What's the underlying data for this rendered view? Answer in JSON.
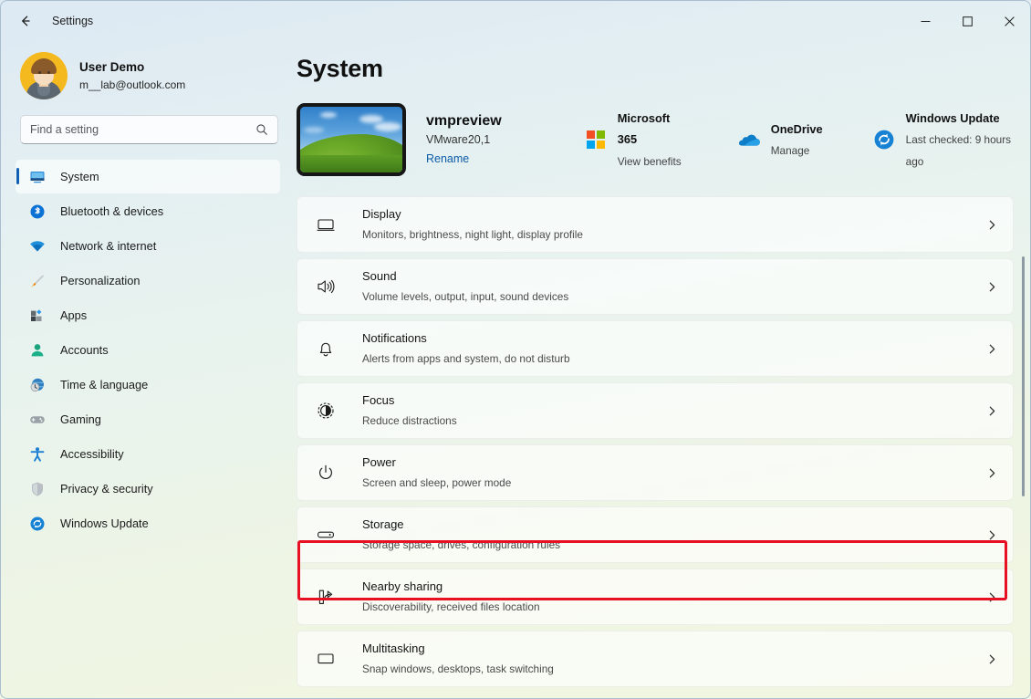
{
  "window": {
    "app_title": "Settings",
    "back_icon": "arrow-left-icon",
    "controls": {
      "minimize": "–",
      "maximize": "□",
      "close": "✕"
    }
  },
  "account": {
    "name": "User Demo",
    "email": "m__lab@outlook.com",
    "avatar_color": "#f5b920"
  },
  "search": {
    "placeholder": "Find a setting",
    "value": "",
    "icon": "search-icon"
  },
  "sidebar": {
    "items": [
      {
        "label": "System",
        "icon": "monitor-icon",
        "selected": true
      },
      {
        "label": "Bluetooth & devices",
        "icon": "bluetooth-icon",
        "selected": false
      },
      {
        "label": "Network & internet",
        "icon": "wifi-icon",
        "selected": false
      },
      {
        "label": "Personalization",
        "icon": "paintbrush-icon",
        "selected": false
      },
      {
        "label": "Apps",
        "icon": "apps-grid-icon",
        "selected": false
      },
      {
        "label": "Accounts",
        "icon": "person-icon",
        "selected": false
      },
      {
        "label": "Time & language",
        "icon": "clock-globe-icon",
        "selected": false
      },
      {
        "label": "Gaming",
        "icon": "gamepad-icon",
        "selected": false
      },
      {
        "label": "Accessibility",
        "icon": "accessibility-person-icon",
        "selected": false
      },
      {
        "label": "Privacy & security",
        "icon": "shield-icon",
        "selected": false
      },
      {
        "label": "Windows Update",
        "icon": "update-sync-icon",
        "selected": false
      }
    ]
  },
  "main": {
    "page_title": "System",
    "device": {
      "name": "vmpreview",
      "model": "VMware20,1",
      "rename_label": "Rename",
      "thumbnail": "bliss-wallpaper-thumbnail"
    },
    "quick_links": [
      {
        "title": "Microsoft 365",
        "subtitle": "View benefits",
        "icon": "microsoft-logo-icon"
      },
      {
        "title": "OneDrive",
        "subtitle": "Manage",
        "icon": "onedrive-cloud-icon"
      },
      {
        "title": "Windows Update",
        "subtitle": "Last checked: 9 hours ago",
        "icon": "update-sync-icon"
      }
    ],
    "settings_rows": [
      {
        "title": "Display",
        "subtitle": "Monitors, brightness, night light, display profile",
        "icon": "monitor-icon",
        "chevron": "chevron-right-icon",
        "highlighted": false
      },
      {
        "title": "Sound",
        "subtitle": "Volume levels, output, input, sound devices",
        "icon": "speaker-icon",
        "chevron": "chevron-right-icon",
        "highlighted": false
      },
      {
        "title": "Notifications",
        "subtitle": "Alerts from apps and system, do not disturb",
        "icon": "bell-icon",
        "chevron": "chevron-right-icon",
        "highlighted": false
      },
      {
        "title": "Focus",
        "subtitle": "Reduce distractions",
        "icon": "focus-moon-icon",
        "chevron": "chevron-right-icon",
        "highlighted": false
      },
      {
        "title": "Power",
        "subtitle": "Screen and sleep, power mode",
        "icon": "power-icon",
        "chevron": "chevron-right-icon",
        "highlighted": false
      },
      {
        "title": "Storage",
        "subtitle": "Storage space, drives, configuration rules",
        "icon": "drive-icon",
        "chevron": "chevron-right-icon",
        "highlighted": true
      },
      {
        "title": "Nearby sharing",
        "subtitle": "Discoverability, received files location",
        "icon": "share-icon",
        "chevron": "chevron-right-icon",
        "highlighted": false
      },
      {
        "title": "Multitasking",
        "subtitle": "Snap windows, desktops, task switching",
        "icon": "multitask-icon",
        "chevron": "chevron-right-icon",
        "highlighted": false
      }
    ]
  },
  "colors": {
    "highlight": "#e81123",
    "accent": "#0f5fb5",
    "link": "#0c5ca8"
  }
}
